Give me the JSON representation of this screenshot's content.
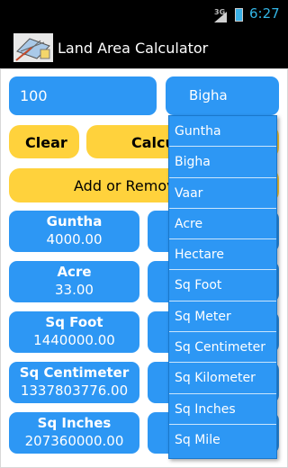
{
  "status_bar": {
    "network": "3G",
    "time": "6:27"
  },
  "app": {
    "title": "Land Area Calculator"
  },
  "input": {
    "value": "100"
  },
  "unit_select": {
    "selected": "Bigha"
  },
  "buttons": {
    "clear": "Clear",
    "calculate": "Calcu",
    "add_remove": "Add or Remov"
  },
  "results": [
    {
      "name": "Guntha",
      "value": "4000.00"
    },
    {
      "name": "Acre",
      "value": "33.00"
    },
    {
      "name": "Sq Foot",
      "value": "1440000.00"
    },
    {
      "name": "Sq Centimeter",
      "value": "1337803776.00"
    },
    {
      "name": "Sq Inches",
      "value": "207360000.00"
    }
  ],
  "dropdown": {
    "options": [
      "Guntha",
      "Bigha",
      "Vaar",
      "Acre",
      "Hectare",
      "Sq Foot",
      "Sq Meter",
      "Sq Centimeter",
      "Sq Kilometer",
      "Sq Inches",
      "Sq Mile"
    ]
  },
  "colors": {
    "accent_blue": "#2d97f4",
    "accent_yellow": "#ffd23c",
    "clock_blue": "#33b5e5"
  }
}
